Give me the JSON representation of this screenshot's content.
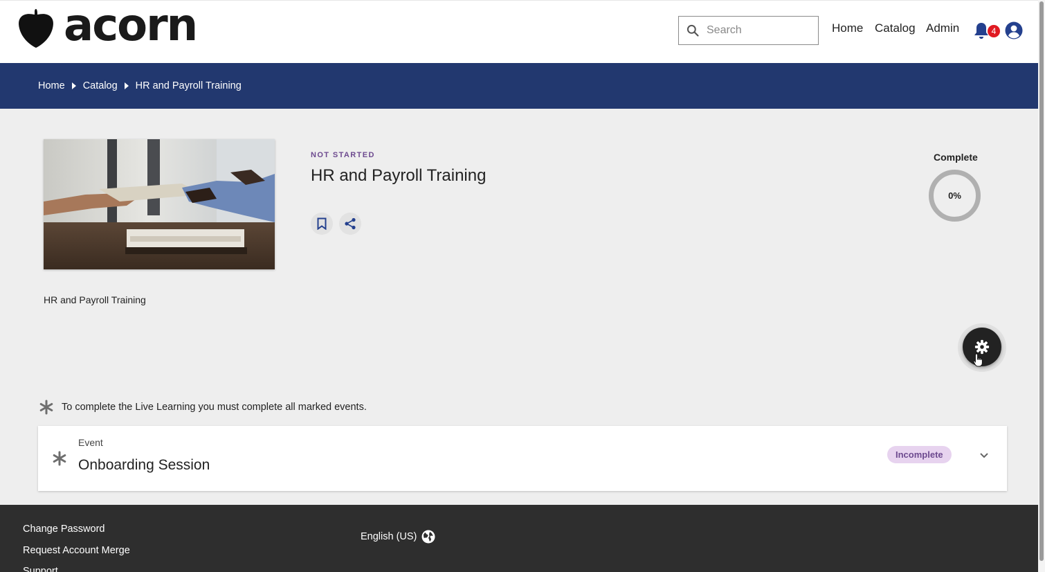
{
  "header": {
    "logo_text": "acorn",
    "search": {
      "placeholder": "Search",
      "value": ""
    },
    "nav": [
      {
        "label": "Home"
      },
      {
        "label": "Catalog"
      },
      {
        "label": "Admin"
      }
    ],
    "notifications_count": "4"
  },
  "breadcrumb": [
    "Home",
    "Catalog",
    "HR and Payroll Training"
  ],
  "course": {
    "status": "NOT STARTED",
    "title": "HR and Payroll Training",
    "caption": "HR and Payroll Training",
    "completion_label": "Complete",
    "completion_percent": "0%",
    "completion_value": 0
  },
  "requirements": {
    "note": "To complete the Live Learning you must complete all marked events."
  },
  "events": [
    {
      "type": "Event",
      "name": "Onboarding Session",
      "status": "Incomplete",
      "required": true
    }
  ],
  "footer": {
    "links": [
      "Change Password",
      "Request Account Merge",
      "Support"
    ],
    "language": "English (US)"
  },
  "colors": {
    "brand_navy": "#22386f",
    "status_purple": "#6d4a8f",
    "pill_bg": "#e7d3ef",
    "badge_red": "#e01a22",
    "footer_bg": "#2e2e2e"
  },
  "icons": [
    "acorn-logo-icon",
    "search-icon",
    "bell-icon",
    "account-circle-icon",
    "bookmark-icon",
    "share-icon",
    "gear-icon",
    "asterisk-icon",
    "chevron-down-icon",
    "globe-icon",
    "hand-cursor-icon"
  ]
}
